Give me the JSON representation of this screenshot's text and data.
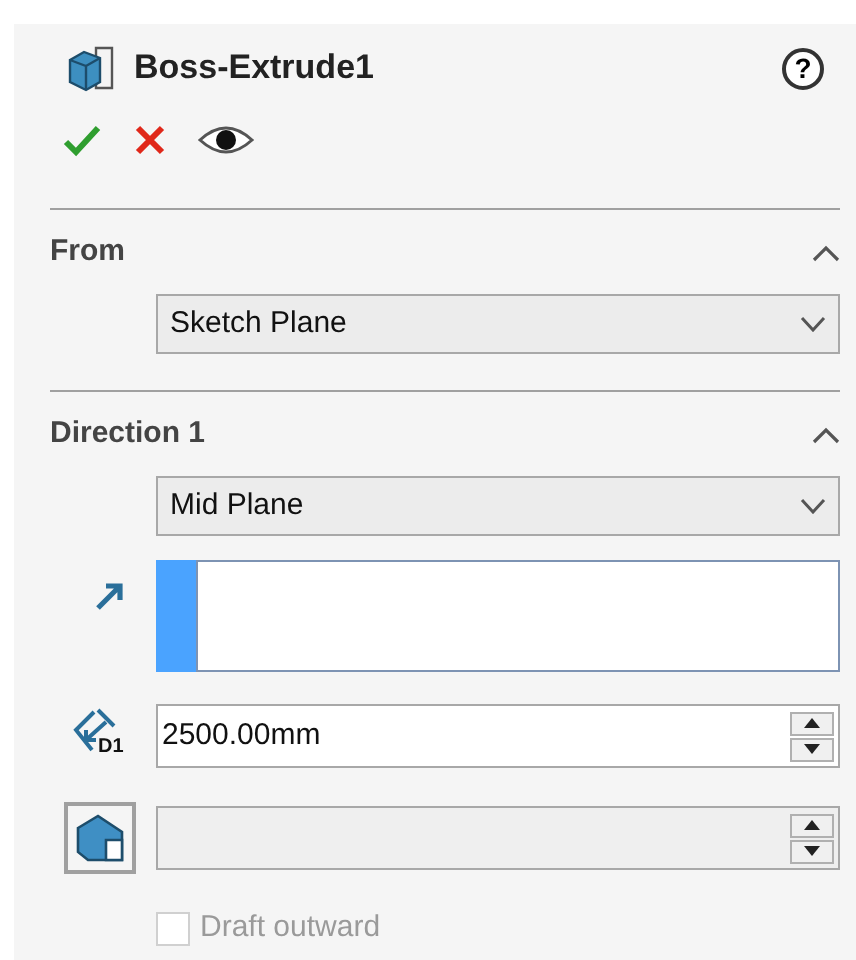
{
  "header": {
    "title": "Boss-Extrude1",
    "help": "?"
  },
  "sections": [
    {
      "title": "From",
      "expanded": true,
      "end_condition": "Sketch Plane"
    },
    {
      "title": "Direction 1",
      "expanded": true,
      "end_condition": "Mid Plane",
      "selection_box": {
        "active": true
      },
      "depth": {
        "icon_label": "D1",
        "value": "2500.00mm"
      },
      "draft": {
        "toggle_selected": false,
        "disabled": true
      },
      "draft_outward": {
        "label": "Draft outward",
        "checked": false,
        "disabled": true
      }
    }
  ]
}
